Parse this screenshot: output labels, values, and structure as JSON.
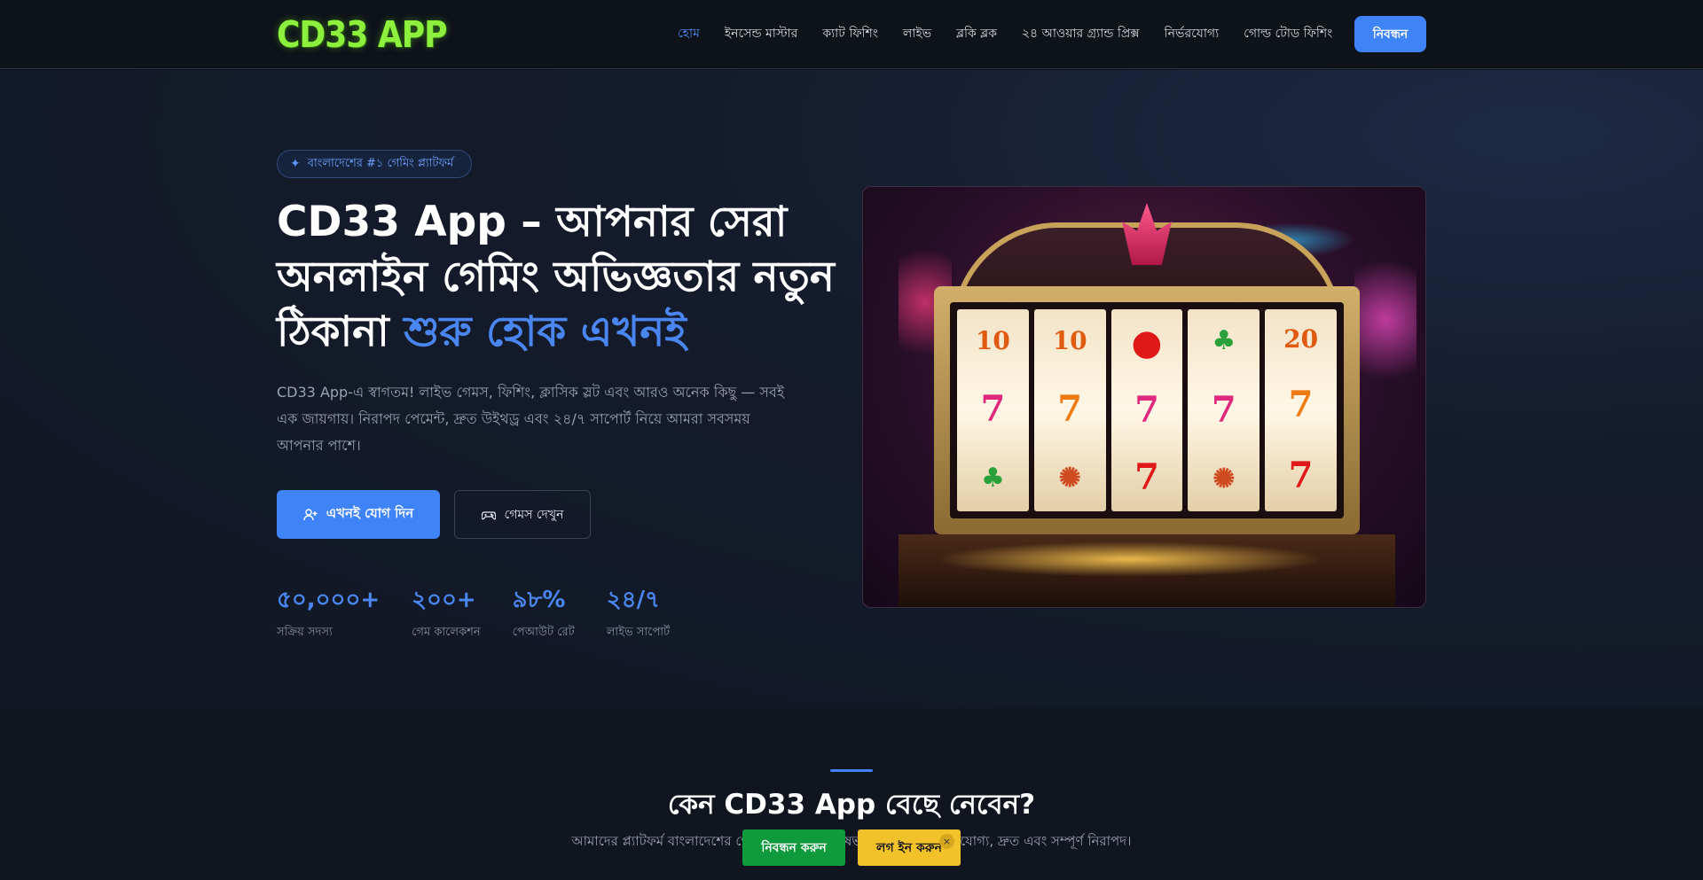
{
  "header": {
    "logo": "CD33 APP",
    "nav": [
      {
        "label": "হোম",
        "active": true
      },
      {
        "label": "ইনসেন্ড মাস্টার",
        "active": false
      },
      {
        "label": "ক্যাট ফিশিং",
        "active": false
      },
      {
        "label": "লাইভ",
        "active": false
      },
      {
        "label": "ব্লকি ব্লক",
        "active": false
      },
      {
        "label": "২৪ আওয়ার গ্র্যান্ড প্রিক্স",
        "active": false
      },
      {
        "label": "নির্ভরযোগ্য",
        "active": false
      },
      {
        "label": "গোল্ড টোড ফিশিং",
        "active": false
      }
    ],
    "cta_label": "নিবন্ধন"
  },
  "hero": {
    "badge_icon": "sparkle-icon",
    "badge": "বাংলাদেশের #১ গেমিং প্ল্যাটফর্ম",
    "headline_main": "CD33 App – আপনার সেরা অনলাইন গেমিং অভিজ্ঞতার নতুন ঠিকানা",
    "headline_accent": "শুরু হোক এখনই",
    "subtext": "CD33 App-এ স্বাগতম! লাইভ গেমস, ফিশিং, ক্লাসিক স্লট এবং আরও অনেক কিছু — সবই এক জায়গায়। নিরাপদ পেমেন্ট, দ্রুত উইথড্র এবং ২৪/৭ সাপোর্ট নিয়ে আমরা সবসময় আপনার পাশে।",
    "primary_button": "এখনই যোগ দিন",
    "secondary_button": "গেমস দেখুন",
    "stats": [
      {
        "value": "৫০,০০০+",
        "label": "সক্রিয় সদস্য"
      },
      {
        "value": "২০০+",
        "label": "গেম কালেকশন"
      },
      {
        "value": "৯৮%",
        "label": "পেআউট রেট"
      },
      {
        "value": "২৪/৭",
        "label": "লাইভ সাপোর্ট"
      }
    ],
    "slot_reels": [
      [
        "10",
        "7",
        "clover"
      ],
      [
        "10",
        "7",
        "chip"
      ],
      [
        "cherry",
        "7",
        "7"
      ],
      [
        "clover",
        "7",
        "chip"
      ],
      [
        "20",
        "7",
        "7"
      ]
    ]
  },
  "section": {
    "title": "কেন CD33 App বেছে নেবেন?",
    "subtitle": "আমাদের প্ল্যাটফর্ম বাংলাদেশের গেমারদের জন্য বিশেষভাবে তৈরি — নির্ভরযোগ্য, দ্রুত এবং সম্পূর্ণ নিরাপদ।"
  },
  "floating_bar": {
    "register": "নিবন্ধন করুন",
    "login": "লগ ইন করুন",
    "close": "×"
  },
  "colors": {
    "accent": "#3f83f8",
    "logo_green": "#8cf03c",
    "register_green": "#0f9a3c",
    "login_yellow": "#f2c22a"
  }
}
